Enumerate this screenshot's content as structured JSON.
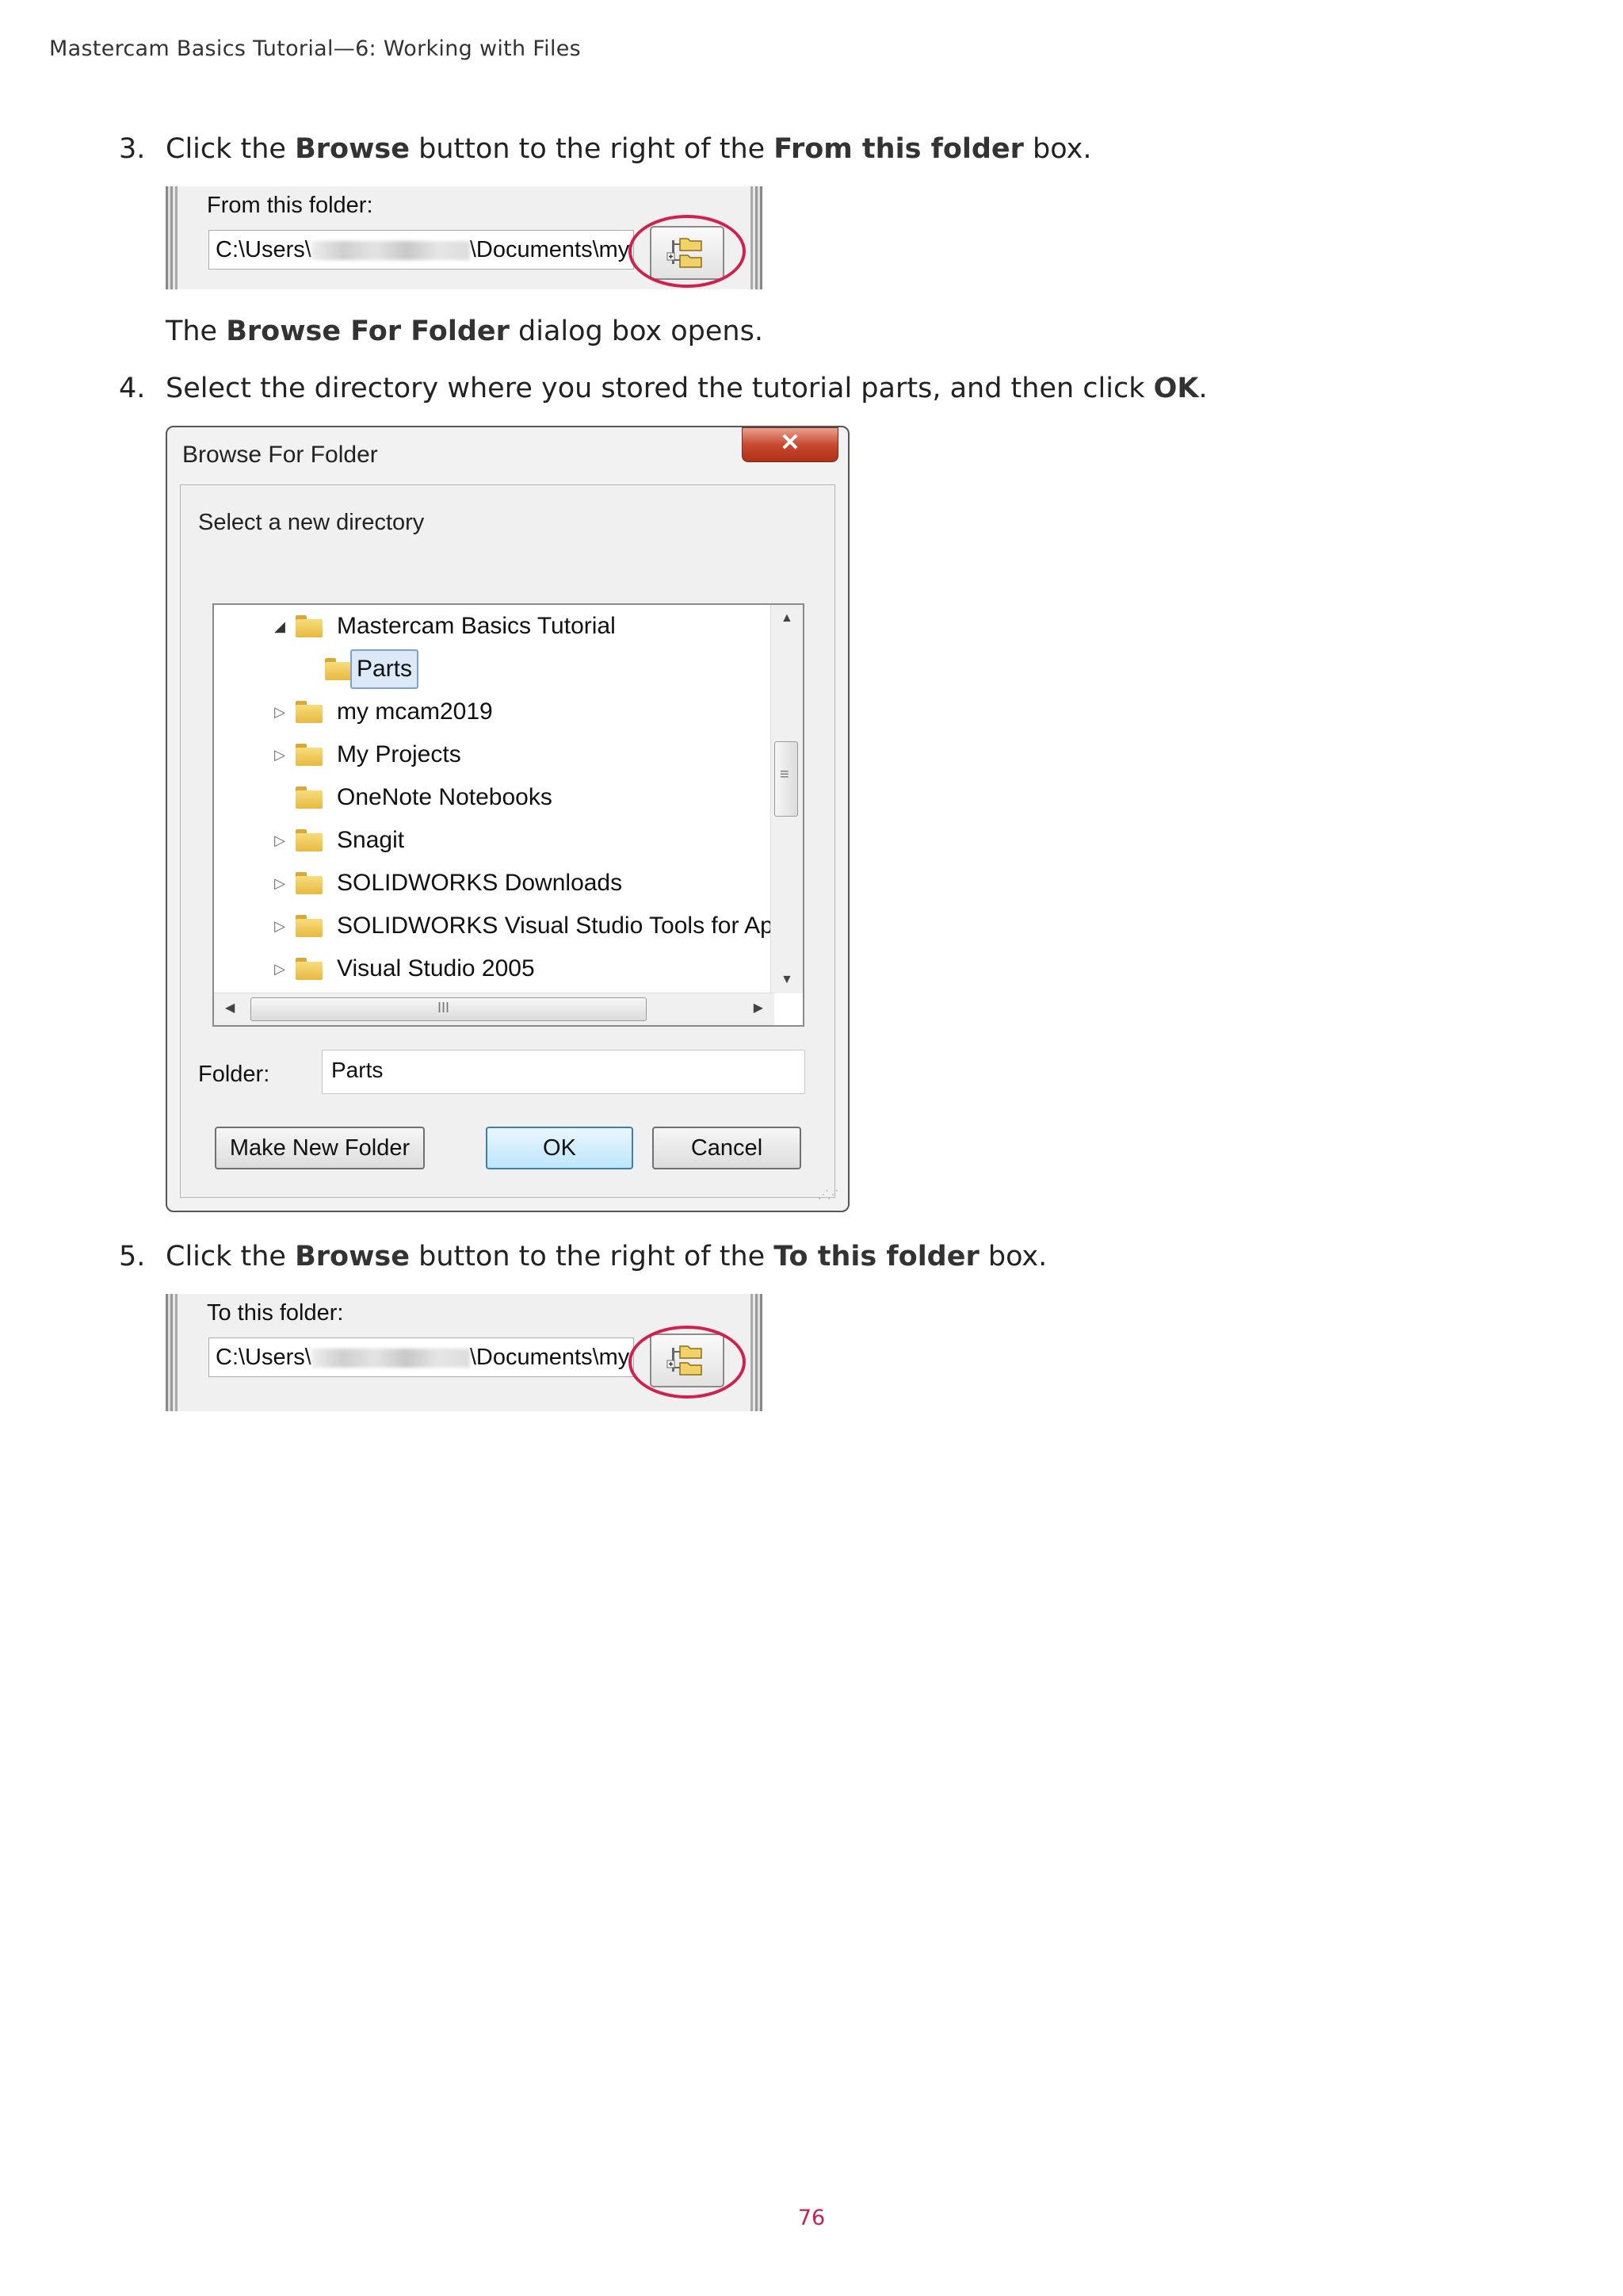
{
  "header": {
    "running_title": "Mastercam Basics Tutorial—6: Working with Files"
  },
  "steps": [
    {
      "number": "3.",
      "parts": [
        "Click the ",
        "Browse",
        " button to the right of the ",
        "From this folder",
        " box."
      ]
    },
    {
      "number": "4.",
      "parts": [
        "Select the directory where you stored the tutorial parts, and then click ",
        "OK",
        "."
      ]
    },
    {
      "number": "5.",
      "parts": [
        "Click the ",
        "Browse",
        " button to the right of the ",
        "To this folder",
        " box."
      ]
    }
  ],
  "note_after_step3": {
    "parts": [
      "The ",
      "Browse For Folder",
      " dialog box opens."
    ]
  },
  "from_field": {
    "label": "From this folder:",
    "path_prefix": "C:\\Users\\",
    "path_suffix": "\\Documents\\my"
  },
  "to_field": {
    "label": "To this folder:",
    "path_prefix": "C:\\Users\\",
    "path_suffix": "\\Documents\\my"
  },
  "dialog": {
    "title": "Browse For Folder",
    "close_symbol": "✕",
    "prompt": "Select a new directory",
    "tree": [
      {
        "label": "Mastercam Basics Tutorial",
        "expander": "◢"
      },
      {
        "label": "Parts",
        "expander": "",
        "selected": true
      },
      {
        "label": "my mcam2019",
        "expander": "▷"
      },
      {
        "label": "My Projects",
        "expander": "▷"
      },
      {
        "label": "OneNote Notebooks",
        "expander": ""
      },
      {
        "label": "Snagit",
        "expander": "▷"
      },
      {
        "label": "SOLIDWORKS Downloads",
        "expander": "▷"
      },
      {
        "label": "SOLIDWORKS Visual Studio Tools for Ap",
        "expander": "▷"
      },
      {
        "label": "Visual Studio 2005",
        "expander": "▷"
      }
    ],
    "folder_label": "Folder:",
    "folder_value": "Parts",
    "buttons": {
      "make_new_folder": "Make New Folder",
      "ok": "OK",
      "cancel": "Cancel"
    }
  },
  "icons": [
    "browse-folder-icon",
    "folder-icon",
    "close-icon",
    "scroll-up-icon",
    "scroll-down-icon",
    "scroll-left-icon",
    "scroll-right-icon"
  ],
  "colors": {
    "highlight_ring": "#d0204e",
    "page_number": "#c0244f",
    "selection": "#dce9f8"
  },
  "footer": {
    "page_number": "76"
  }
}
